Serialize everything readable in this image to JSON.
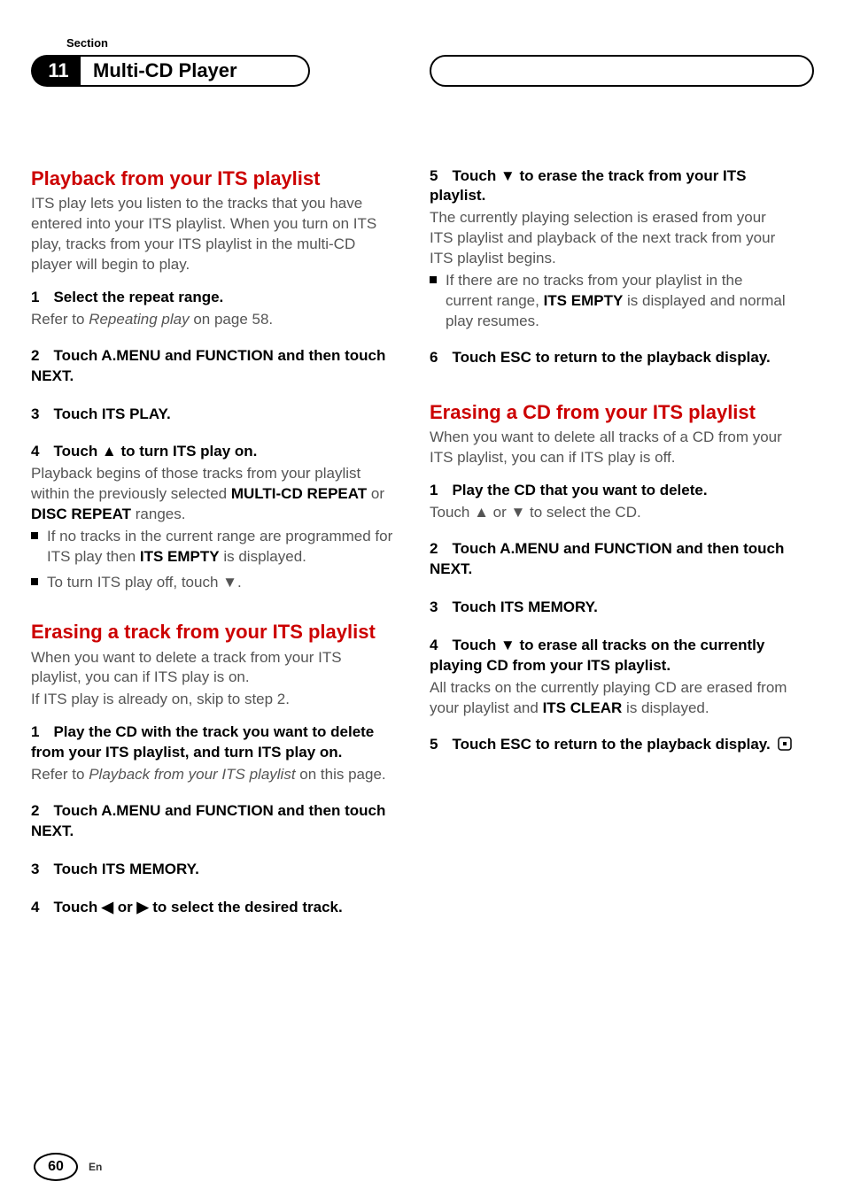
{
  "header": {
    "section_label": "Section",
    "section_number": "11",
    "title": "Multi-CD Player"
  },
  "left": {
    "h1": "Playback from your ITS playlist",
    "intro": "ITS play lets you listen to the tracks that you have entered into your ITS playlist. When you turn on ITS play, tracks from your ITS playlist in the multi-CD player will begin to play.",
    "s1_title": "Select the repeat range.",
    "s1_body_a": "Refer to ",
    "s1_body_b": "Repeating play",
    "s1_body_c": " on page 58.",
    "s2_title": "Touch A.MENU and FUNCTION and then touch NEXT.",
    "s3_title": "Touch ITS PLAY.",
    "s4_title": "Touch ▲ to turn ITS play on.",
    "s4_body_a": "Playback begins of those tracks from your playlist within the previously selected ",
    "s4_body_b": "MULTI-CD REPEAT",
    "s4_body_c": " or ",
    "s4_body_d": "DISC REPEAT",
    "s4_body_e": " ranges.",
    "s4_bullet1_a": "If no tracks in the current range are programmed for ITS play then ",
    "s4_bullet1_b": "ITS EMPTY",
    "s4_bullet1_c": " is displayed.",
    "s4_bullet2": "To turn ITS play off, touch ▼.",
    "h2": "Erasing a track from your ITS playlist",
    "et_intro_a": "When you want to delete a track from your ITS playlist, you can if ITS play is on.",
    "et_intro_b": "If ITS play is already on, skip to step 2.",
    "et_s1_title": "Play the CD with the track you want to delete from your ITS playlist, and turn ITS play on.",
    "et_s1_body_a": "Refer to ",
    "et_s1_body_b": "Playback from your ITS playlist",
    "et_s1_body_c": " on this page.",
    "et_s2_title": "Touch A.MENU and FUNCTION and then touch NEXT.",
    "et_s3_title": "Touch ITS MEMORY.",
    "et_s4_title": "Touch ◀ or ▶ to select the desired track."
  },
  "right": {
    "s5_title": "Touch ▼ to erase the track from your ITS playlist.",
    "s5_body": "The currently playing selection is erased from your ITS playlist and playback of the next track from your ITS playlist begins.",
    "s5_bullet_a": "If there are no tracks from your playlist in the current range, ",
    "s5_bullet_b": "ITS EMPTY",
    "s5_bullet_c": " is displayed and normal play resumes.",
    "s6_title": "Touch ESC to return to the playback display.",
    "h3": "Erasing a CD from your ITS playlist",
    "ec_intro": "When you want to delete all tracks of a CD from your ITS playlist, you can if ITS play is off.",
    "ec_s1_title": "Play the CD that you want to delete.",
    "ec_s1_body": "Touch ▲ or ▼ to select the CD.",
    "ec_s2_title": "Touch A.MENU and FUNCTION and then touch NEXT.",
    "ec_s3_title": "Touch ITS MEMORY.",
    "ec_s4_title": "Touch ▼ to erase all tracks on the currently playing CD from your ITS playlist.",
    "ec_s4_body_a": "All tracks on the currently playing CD are erased from your playlist and ",
    "ec_s4_body_b": "ITS CLEAR",
    "ec_s4_body_c": " is displayed.",
    "ec_s5_title": "Touch ESC to return to the playback display."
  },
  "footer": {
    "page": "60",
    "lang": "En"
  },
  "nums": {
    "n1": "1",
    "n2": "2",
    "n3": "3",
    "n4": "4",
    "n5": "5",
    "n6": "6"
  }
}
